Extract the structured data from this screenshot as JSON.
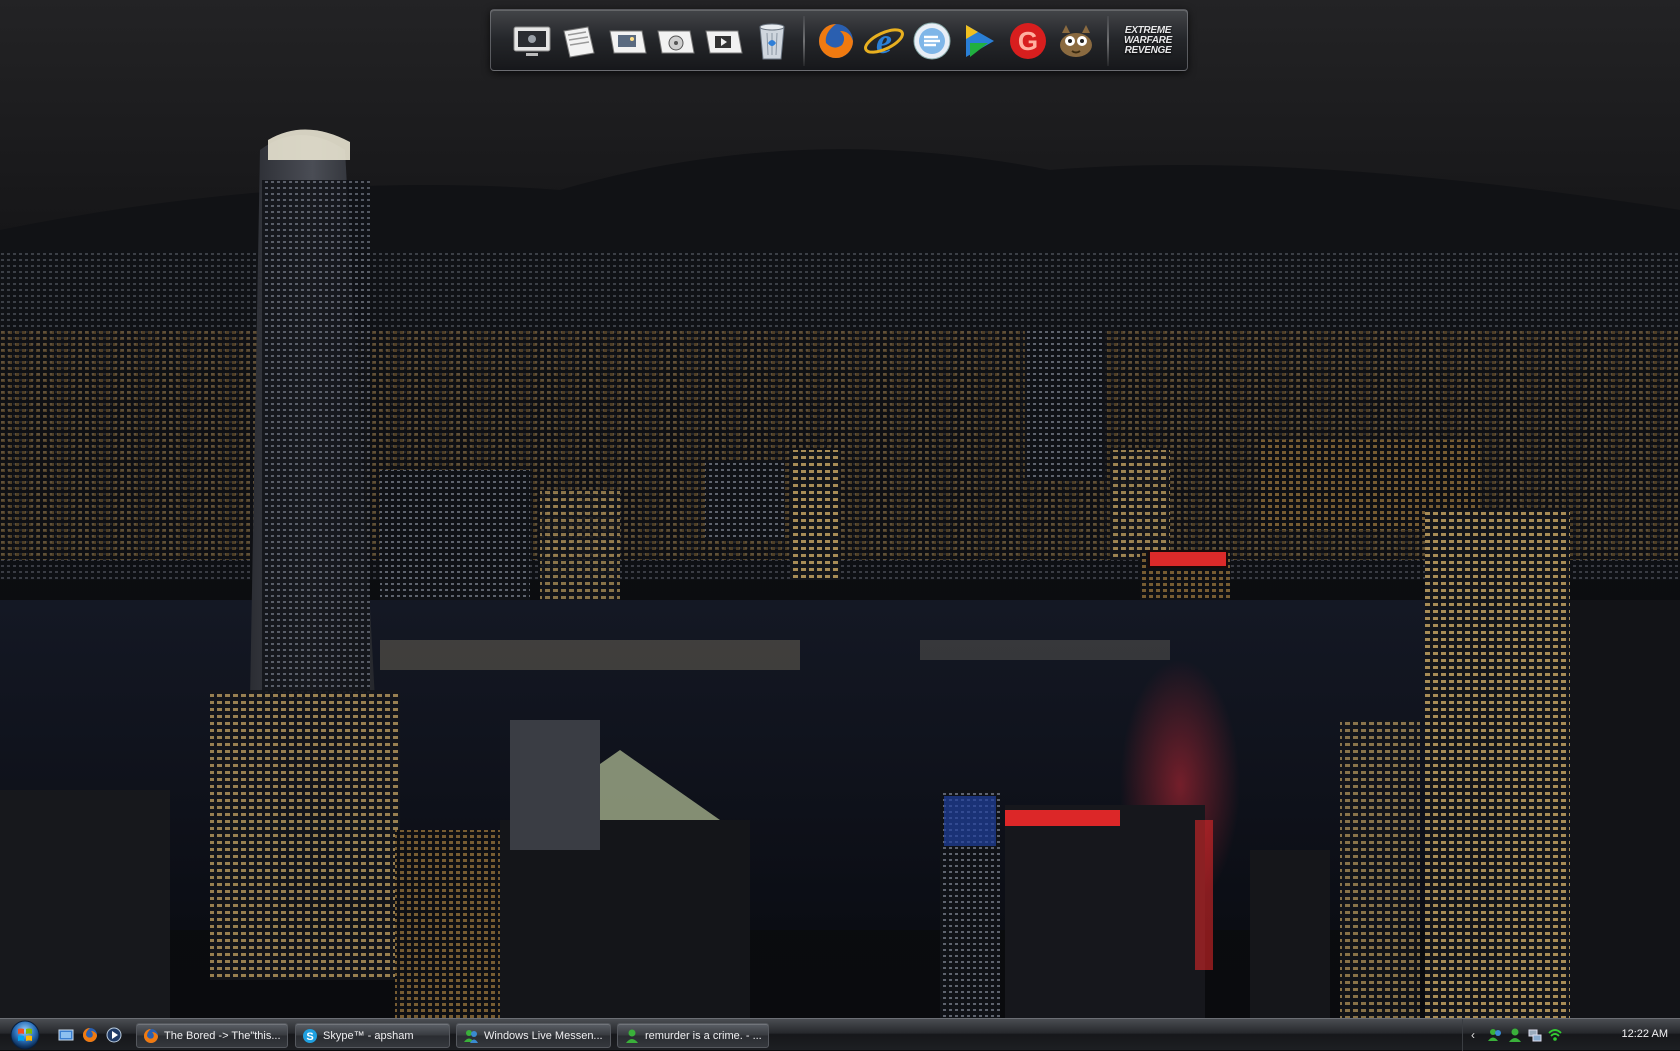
{
  "dock": {
    "items": [
      {
        "name": "monitor-icon",
        "label": ""
      },
      {
        "name": "documents-icon",
        "label": ""
      },
      {
        "name": "pictures-icon",
        "label": ""
      },
      {
        "name": "music-icon",
        "label": ""
      },
      {
        "name": "videos-icon",
        "label": ""
      },
      {
        "name": "recycle-bin-icon",
        "label": ""
      },
      {
        "name": "firefox-icon",
        "label": ""
      },
      {
        "name": "internet-explorer-icon",
        "label": ""
      },
      {
        "name": "skype-style-icon",
        "label": ""
      },
      {
        "name": "media-icon",
        "label": ""
      },
      {
        "name": "red-g-icon",
        "label": ""
      },
      {
        "name": "gimp-icon",
        "label": ""
      }
    ],
    "game_label": "EXTREME\nWARFARE\nREVENGE"
  },
  "taskbar": {
    "tasks": [
      {
        "label": "The Bored -> The\"this...",
        "icon": "firefox-icon"
      },
      {
        "label": "Skype™ - apsham",
        "icon": "skype-icon"
      },
      {
        "label": "Windows Live Messen...",
        "icon": "messenger-icon"
      },
      {
        "label": "remurder is a crime. - ...",
        "icon": "messenger-chat-icon"
      }
    ],
    "clock": "12:22 AM"
  },
  "colors": {
    "accent_neon_red": "#ff2a2a",
    "firefox_orange": "#f07a10",
    "ie_blue": "#2a7fd6"
  }
}
